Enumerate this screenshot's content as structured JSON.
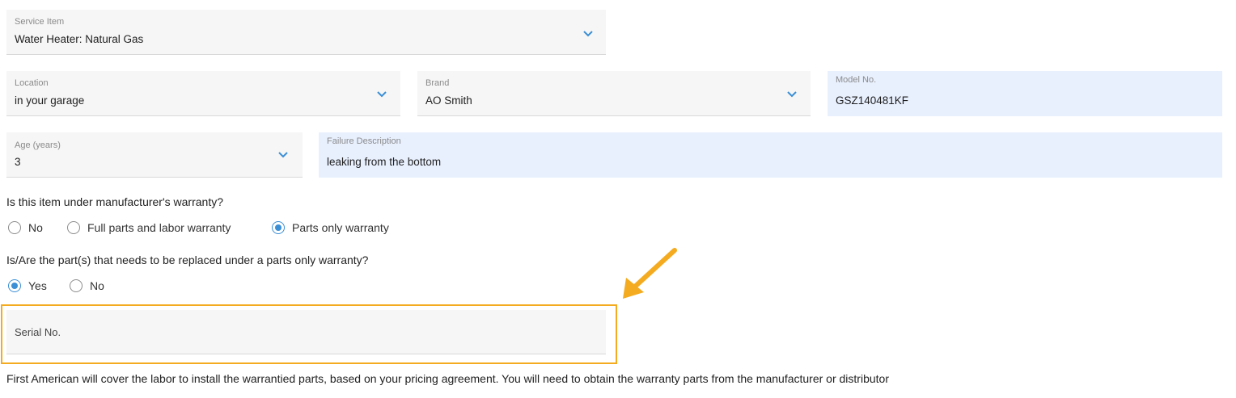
{
  "service_item": {
    "label": "Service Item",
    "value": "Water Heater: Natural Gas"
  },
  "location": {
    "label": "Location",
    "value": "in your garage"
  },
  "brand": {
    "label": "Brand",
    "value": "AO Smith"
  },
  "model": {
    "label": "Model No.",
    "value": "GSZ140481KF"
  },
  "age": {
    "label": "Age (years)",
    "value": "3"
  },
  "failure": {
    "label": "Failure Description",
    "value": "leaking from the bottom"
  },
  "warranty_question": {
    "text": "Is this item under manufacturer's warranty?",
    "options": [
      "No",
      "Full parts and labor warranty",
      "Parts only warranty"
    ],
    "selected": "Parts only warranty"
  },
  "parts_question": {
    "text": "Is/Are the part(s) that needs to be replaced under a parts only warranty?",
    "options": [
      "Yes",
      "No"
    ],
    "selected": "Yes"
  },
  "serial": {
    "label": "Serial No.",
    "value": ""
  },
  "footer_text": "First American will cover the labor to install the warrantied parts, based on your pricing agreement. You will need to obtain the warranty parts from the manufacturer or distributor",
  "colors": {
    "accent": "#3b8fd5",
    "highlight": "#f4ab1f",
    "field_blue": "#e8f0fe"
  },
  "icons": {
    "dropdown": "chevron-down-icon",
    "annotation": "arrow-icon"
  }
}
